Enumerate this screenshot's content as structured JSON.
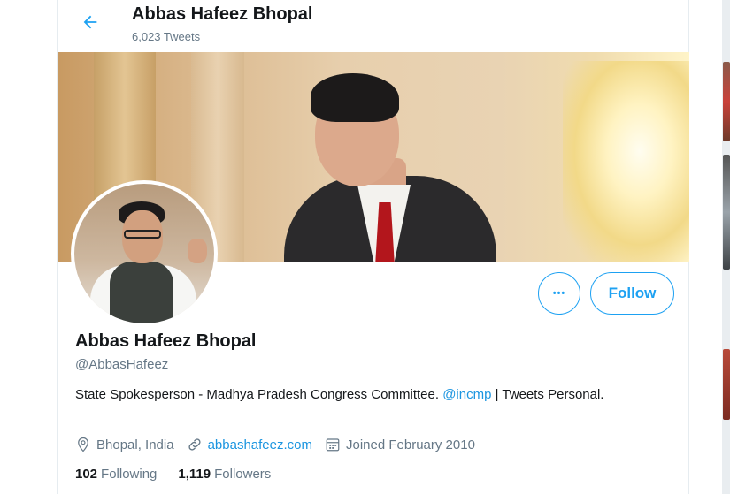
{
  "header": {
    "name": "Abbas Hafeez Bhopal",
    "tweet_count": "6,023 Tweets"
  },
  "profile": {
    "name": "Abbas Hafeez Bhopal",
    "handle": "@AbbasHafeez",
    "bio_text": "State Spokesperson - Madhya Pradesh Congress Committee. ",
    "bio_mention": "@incmp",
    "bio_suffix": " | Tweets Personal.",
    "location": "Bhopal, India",
    "website": "abbashafeez.com",
    "joined": "Joined February 2010"
  },
  "actions": {
    "more_glyph": "•••",
    "follow_label": "Follow"
  },
  "stats": {
    "following_count": "102",
    "following_label": "Following",
    "followers_count": "1,119",
    "followers_label": "Followers"
  },
  "colors": {
    "accent": "#1da1f2",
    "link": "#1b95e0",
    "secondary_text": "#657786",
    "primary_text": "#14171a"
  },
  "icons": {
    "back": "arrow-left-icon",
    "location": "map-pin-icon",
    "website": "link-icon",
    "joined": "calendar-icon",
    "more": "more-icon"
  }
}
